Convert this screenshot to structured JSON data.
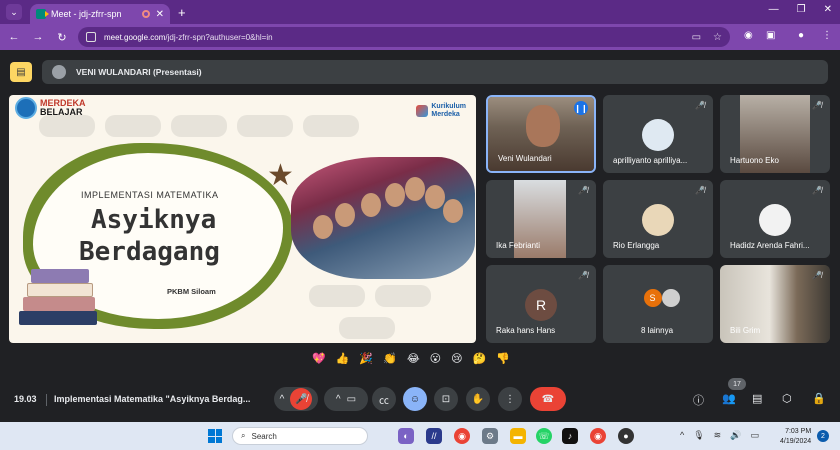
{
  "browser": {
    "tab_title": "Meet - jdj-zfrr-spn",
    "url_host": "meet.google.com",
    "url_path": "/jdj-zfrr-spn?authuser=0&hl=in"
  },
  "presentation": {
    "presenter_label": "VENI WULANDARI (Presentasi)"
  },
  "slide": {
    "logo_left_line1": "MERDEKA",
    "logo_left_line2": "BELAJAR",
    "logo_right_line1": "Kurikulum",
    "logo_right_line2": "Merdeka",
    "subtitle": "IMPLEMENTASI MATEMATIKA",
    "title_line1": "Asyiknya",
    "title_line2": "Berdagang",
    "org": "PKBM Siloam"
  },
  "participants": [
    {
      "name": "Veni Wulandari",
      "speaking": true
    },
    {
      "name": "aprilliyanto aprilliya...",
      "muted": true
    },
    {
      "name": "Hartuono Eko",
      "muted": true
    },
    {
      "name": "Ika Febrianti",
      "muted": true
    },
    {
      "name": "Rio Erlangga",
      "muted": true
    },
    {
      "name": "Hadidz Arenda Fahri...",
      "muted": true
    },
    {
      "name": "Raka hans Hans",
      "initial": "R",
      "muted": true
    },
    {
      "name": "8 lainnya",
      "initial": "S"
    },
    {
      "name": "Bili Grim",
      "muted": true
    }
  ],
  "reactions": [
    "💖",
    "👍",
    "🎉",
    "👏",
    "😂",
    "😮",
    "😢",
    "🤔",
    "👎"
  ],
  "controls": {
    "time": "19.03",
    "meeting_title": "Implementasi Matematika \"Asyiknya Berdag...",
    "people_count": "17"
  },
  "taskbar": {
    "search_placeholder": "Search",
    "time": "7:03 PM",
    "date": "4/19/2024",
    "notif_count": "2"
  },
  "colors": {
    "browser_frame": "#7e47ad",
    "meet_bg": "#202124",
    "tile_bg": "#3c4043",
    "end_call": "#ea4335",
    "accent": "#8ab4f8"
  }
}
